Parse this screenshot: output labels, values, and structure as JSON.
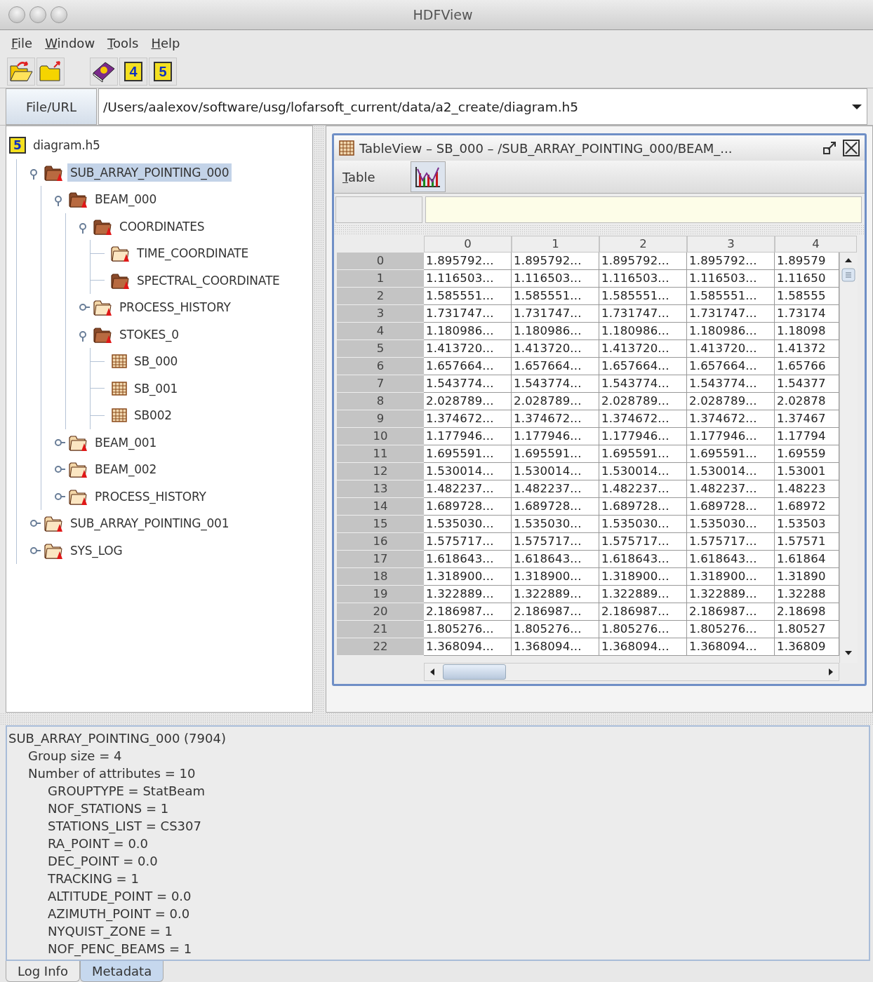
{
  "window": {
    "title": "HDFView"
  },
  "menu": [
    "File",
    "Window",
    "Tools",
    "Help"
  ],
  "toolbar": [
    {
      "kind": "open"
    },
    {
      "kind": "close"
    },
    {
      "kind": "help"
    },
    {
      "kind": "hdf",
      "glyph": "4"
    },
    {
      "kind": "hdf",
      "glyph": "5"
    }
  ],
  "url_bar": {
    "button": "File/URL",
    "value": "/Users/aalexov/software/usg/lofarsoft_current/data/a2_create/diagram.h5"
  },
  "tree": {
    "root": {
      "label": "diagram.h5",
      "glyph": "5",
      "selected": false,
      "children": [
        {
          "label": "SUB_ARRAY_POINTING_000",
          "kind": "darkgroup",
          "expanded": true,
          "selected": true,
          "children": [
            {
              "label": "BEAM_000",
              "kind": "darkgroup",
              "expanded": true,
              "selected": false,
              "children": [
                {
                  "label": "COORDINATES",
                  "kind": "darkgroup",
                  "expanded": true,
                  "selected": false,
                  "children": [
                    {
                      "label": "TIME_COORDINATE",
                      "kind": "group",
                      "selected": false
                    },
                    {
                      "label": "SPECTRAL_COORDINATE",
                      "kind": "darkgroup",
                      "selected": false
                    }
                  ]
                },
                {
                  "label": "PROCESS_HISTORY",
                  "kind": "group",
                  "expanded": false,
                  "selected": false
                },
                {
                  "label": "STOKES_0",
                  "kind": "darkgroup",
                  "expanded": true,
                  "selected": false,
                  "children": [
                    {
                      "label": "SB_000",
                      "kind": "dataset",
                      "selected": false
                    },
                    {
                      "label": "SB_001",
                      "kind": "dataset",
                      "selected": false
                    },
                    {
                      "label": "SB002",
                      "kind": "dataset",
                      "selected": false
                    }
                  ]
                }
              ]
            },
            {
              "label": "BEAM_001",
              "kind": "group",
              "expanded": false,
              "selected": false
            },
            {
              "label": "BEAM_002",
              "kind": "group",
              "expanded": false,
              "selected": false
            },
            {
              "label": "PROCESS_HISTORY",
              "kind": "group",
              "expanded": false,
              "selected": false
            }
          ]
        },
        {
          "label": "SUB_ARRAY_POINTING_001",
          "kind": "group",
          "expanded": false,
          "selected": false
        },
        {
          "label": "SYS_LOG",
          "kind": "group",
          "expanded": false,
          "selected": false
        }
      ]
    }
  },
  "table_view": {
    "title": "TableView  –  SB_000  –  /SUB_ARRAY_POINTING_000/BEAM_...",
    "menu": "Table",
    "columns": [
      "0",
      "1",
      "2",
      "3",
      "4"
    ],
    "rows": [
      {
        "header": "0",
        "cells": [
          "1.895792...",
          "1.895792...",
          "1.895792...",
          "1.895792...",
          "1.89579"
        ]
      },
      {
        "header": "1",
        "cells": [
          "1.116503...",
          "1.116503...",
          "1.116503...",
          "1.116503...",
          "1.11650"
        ]
      },
      {
        "header": "2",
        "cells": [
          "1.585551...",
          "1.585551...",
          "1.585551...",
          "1.585551...",
          "1.58555"
        ]
      },
      {
        "header": "3",
        "cells": [
          "1.731747...",
          "1.731747...",
          "1.731747...",
          "1.731747...",
          "1.73174"
        ]
      },
      {
        "header": "4",
        "cells": [
          "1.180986...",
          "1.180986...",
          "1.180986...",
          "1.180986...",
          "1.18098"
        ]
      },
      {
        "header": "5",
        "cells": [
          "1.413720...",
          "1.413720...",
          "1.413720...",
          "1.413720...",
          "1.41372"
        ]
      },
      {
        "header": "6",
        "cells": [
          "1.657664...",
          "1.657664...",
          "1.657664...",
          "1.657664...",
          "1.65766"
        ]
      },
      {
        "header": "7",
        "cells": [
          "1.543774...",
          "1.543774...",
          "1.543774...",
          "1.543774...",
          "1.54377"
        ]
      },
      {
        "header": "8",
        "cells": [
          "2.028789...",
          "2.028789...",
          "2.028789...",
          "2.028789...",
          "2.02878"
        ]
      },
      {
        "header": "9",
        "cells": [
          "1.374672...",
          "1.374672...",
          "1.374672...",
          "1.374672...",
          "1.37467"
        ]
      },
      {
        "header": "10",
        "cells": [
          "1.177946...",
          "1.177946...",
          "1.177946...",
          "1.177946...",
          "1.17794"
        ]
      },
      {
        "header": "11",
        "cells": [
          "1.695591...",
          "1.695591...",
          "1.695591...",
          "1.695591...",
          "1.69559"
        ]
      },
      {
        "header": "12",
        "cells": [
          "1.530014...",
          "1.530014...",
          "1.530014...",
          "1.530014...",
          "1.53001"
        ]
      },
      {
        "header": "13",
        "cells": [
          "1.482237...",
          "1.482237...",
          "1.482237...",
          "1.482237...",
          "1.48223"
        ]
      },
      {
        "header": "14",
        "cells": [
          "1.689728...",
          "1.689728...",
          "1.689728...",
          "1.689728...",
          "1.68972"
        ]
      },
      {
        "header": "15",
        "cells": [
          "1.535030...",
          "1.535030...",
          "1.535030...",
          "1.535030...",
          "1.53503"
        ]
      },
      {
        "header": "16",
        "cells": [
          "1.575717...",
          "1.575717...",
          "1.575717...",
          "1.575717...",
          "1.57571"
        ]
      },
      {
        "header": "17",
        "cells": [
          "1.618643...",
          "1.618643...",
          "1.618643...",
          "1.618643...",
          "1.61864"
        ]
      },
      {
        "header": "18",
        "cells": [
          "1.318900...",
          "1.318900...",
          "1.318900...",
          "1.318900...",
          "1.31890"
        ]
      },
      {
        "header": "19",
        "cells": [
          "1.322889...",
          "1.322889...",
          "1.322889...",
          "1.322889...",
          "1.32288"
        ]
      },
      {
        "header": "20",
        "cells": [
          "2.186987...",
          "2.186987...",
          "2.186987...",
          "2.186987...",
          "2.18698"
        ]
      },
      {
        "header": "21",
        "cells": [
          "1.805276...",
          "1.805276...",
          "1.805276...",
          "1.805276...",
          "1.80527"
        ]
      },
      {
        "header": "22",
        "cells": [
          "1.368094...",
          "1.368094...",
          "1.368094...",
          "1.368094...",
          "1.36809"
        ]
      }
    ]
  },
  "metadata": {
    "lines": [
      {
        "text": "SUB_ARRAY_POINTING_000 (7904)",
        "children": [
          {
            "text": "Group size = 4"
          },
          {
            "text": "Number of attributes = 10",
            "children": [
              {
                "text": "GROUPTYPE = StatBeam"
              },
              {
                "text": "NOF_STATIONS = 1"
              },
              {
                "text": "STATIONS_LIST = CS307"
              },
              {
                "text": "RA_POINT = 0.0"
              },
              {
                "text": "DEC_POINT = 0.0"
              },
              {
                "text": "TRACKING = 1"
              },
              {
                "text": "ALTITUDE_POINT = 0.0"
              },
              {
                "text": "AZIMUTH_POINT = 0.0"
              },
              {
                "text": "NYQUIST_ZONE = 1"
              },
              {
                "text": "NOF_PENC_BEAMS = 1"
              }
            ]
          }
        ]
      }
    ]
  },
  "bottom_tabs": [
    {
      "label": "Log Info",
      "selected": false
    },
    {
      "label": "Metadata",
      "selected": true
    }
  ]
}
